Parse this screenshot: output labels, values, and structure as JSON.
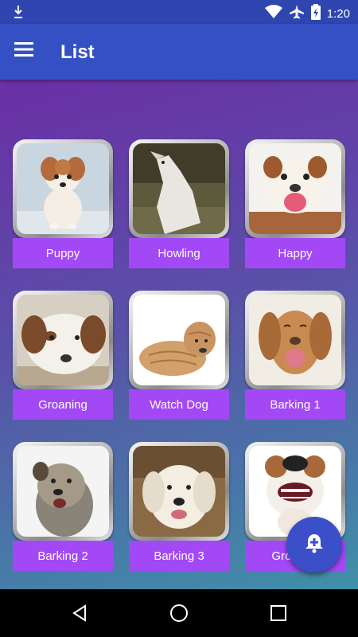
{
  "status_bar": {
    "time": "1:20",
    "icons": [
      "download-icon",
      "wifi-icon",
      "airplane-icon",
      "battery-charging-icon"
    ]
  },
  "app_bar": {
    "menu_icon": "hamburger-menu-icon",
    "title": "List"
  },
  "sounds": [
    {
      "label": "Puppy",
      "image": "puppy-photo"
    },
    {
      "label": "Howling",
      "image": "howling-wolf-photo"
    },
    {
      "label": "Happy",
      "image": "happy-bulldog-photo"
    },
    {
      "label": "Groaning",
      "image": "groaning-dog-photo"
    },
    {
      "label": "Watch Dog",
      "image": "shar-pei-photo"
    },
    {
      "label": "Barking 1",
      "image": "barking-dog-photo"
    },
    {
      "label": "Barking 2",
      "image": "terrier-barking-photo"
    },
    {
      "label": "Barking 3",
      "image": "retriever-photo"
    },
    {
      "label": "Growling",
      "image": "growling-dog-photo"
    }
  ],
  "fab": {
    "icon": "alarm-add-icon"
  },
  "nav_bar": {
    "icons": [
      "back-icon",
      "home-icon",
      "recents-icon"
    ]
  },
  "colors": {
    "app_bar": "#3550c4",
    "status_bar": "#2f46b0",
    "label_bg": "#a249f5",
    "fab": "#3b4fc9",
    "gradient_top": "#6a2fa6",
    "gradient_bottom": "#4090a8"
  }
}
